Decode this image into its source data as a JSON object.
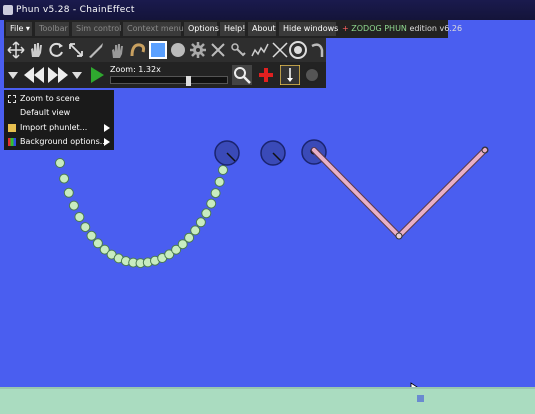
{
  "window": {
    "title": "Phun v5.28 - ChainEffect"
  },
  "menubar": {
    "file": "File ▾",
    "toolbar": "Toolbar",
    "sim_control": "Sim control",
    "context_menu": "Context menu",
    "options": "Options",
    "help": "Help!",
    "about": "About",
    "hide_windows": "Hide windows",
    "brand_prefix": "+",
    "brand_name": "ZODOG PHUN",
    "brand_suffix": "edition v6.26"
  },
  "sim_toolbar": {
    "zoom_label": "Zoom: 1.32x",
    "zoom_level": 1.32
  },
  "context_menu": {
    "items": [
      {
        "label": "Zoom to scene",
        "icon": "zoom-scene-icon",
        "submenu": false
      },
      {
        "label": "Default view",
        "icon": "",
        "submenu": false
      },
      {
        "label": "Import phunlet...",
        "icon": "folder-icon",
        "submenu": true
      },
      {
        "label": "Background options...",
        "icon": "palette-icon",
        "submenu": true
      }
    ]
  },
  "colors": {
    "background": "#4a5ef0",
    "ground": "#aadcc0",
    "chain_bead": "#c8ecc0",
    "wheel": "#3a4ab8",
    "rod": "#e8b0c8",
    "toolbar": "#2e2e2e",
    "selected_tool": "#5aa0ff"
  }
}
